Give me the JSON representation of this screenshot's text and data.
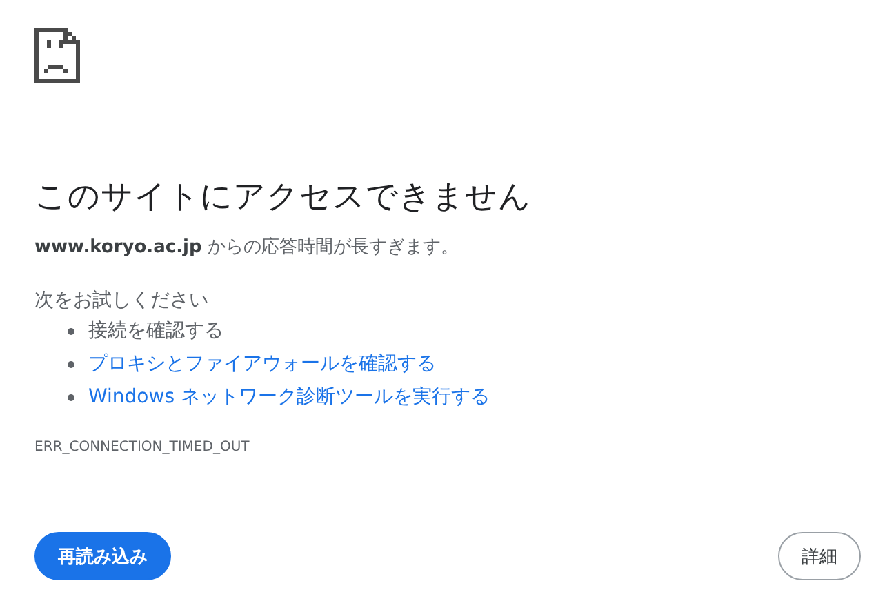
{
  "error_page": {
    "title": "このサイトにアクセスできません",
    "message": "**www.koryo.ac.jp** からの応答時間が長すぎます。",
    "suggestions_heading": "次をお試しください",
    "suggestions": [
      {
        "kind": "text",
        "label": "接続を確認する"
      },
      {
        "kind": "link",
        "label": "プロキシとファイアウォールを確認する"
      },
      {
        "kind": "link",
        "label": "Windows ネットワーク診断ツールを実行する"
      }
    ],
    "error_code": "ERR_CONNECTION_TIMED_OUT",
    "buttons": [
      {
        "kind": "primary",
        "label": "再読み込み"
      },
      {
        "kind": "secondary",
        "label": "詳細"
      }
    ]
  }
}
